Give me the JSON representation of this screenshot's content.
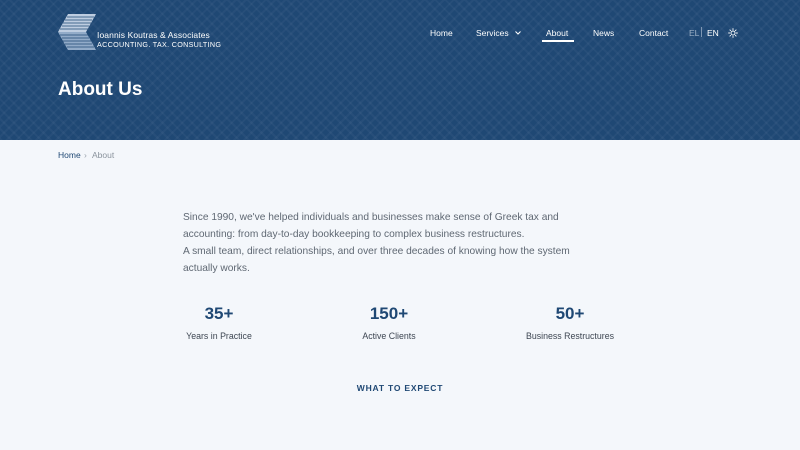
{
  "header": {
    "logo": {
      "name": "Ioannis Koutras & Associates",
      "tagline": "ACCOUNTING. TAX. CONSULTING"
    },
    "nav": [
      {
        "label": "Home",
        "active": false
      },
      {
        "label": "Services",
        "active": false,
        "has_dropdown": true
      },
      {
        "label": "About",
        "active": true
      },
      {
        "label": "News",
        "active": false
      },
      {
        "label": "Contact",
        "active": false
      }
    ],
    "languages": [
      {
        "code": "EL",
        "active": false
      },
      {
        "code": "EN",
        "active": true
      }
    ],
    "theme_toggle_icon": "sun-icon"
  },
  "hero": {
    "title": "About Us"
  },
  "breadcrumb": {
    "home": "Home",
    "separator": "›",
    "current": "About"
  },
  "intro": {
    "paragraph_1": "Since 1990, we've helped individuals and businesses make sense of Greek tax and accounting: from day-to-day bookkeeping to complex business restructures.",
    "paragraph_2": "A small team, direct relationships, and over three decades of knowing how the system actually works."
  },
  "stats": [
    {
      "value": "35+",
      "label": "Years in Practice"
    },
    {
      "value": "150+",
      "label": "Active Clients"
    },
    {
      "value": "50+",
      "label": "Business Restructures"
    }
  ],
  "section": {
    "heading": "WHAT TO EXPECT"
  },
  "colors": {
    "brand_navy": "#1f4874",
    "page_background": "#f4f7fb",
    "body_text": "#5f6873"
  }
}
